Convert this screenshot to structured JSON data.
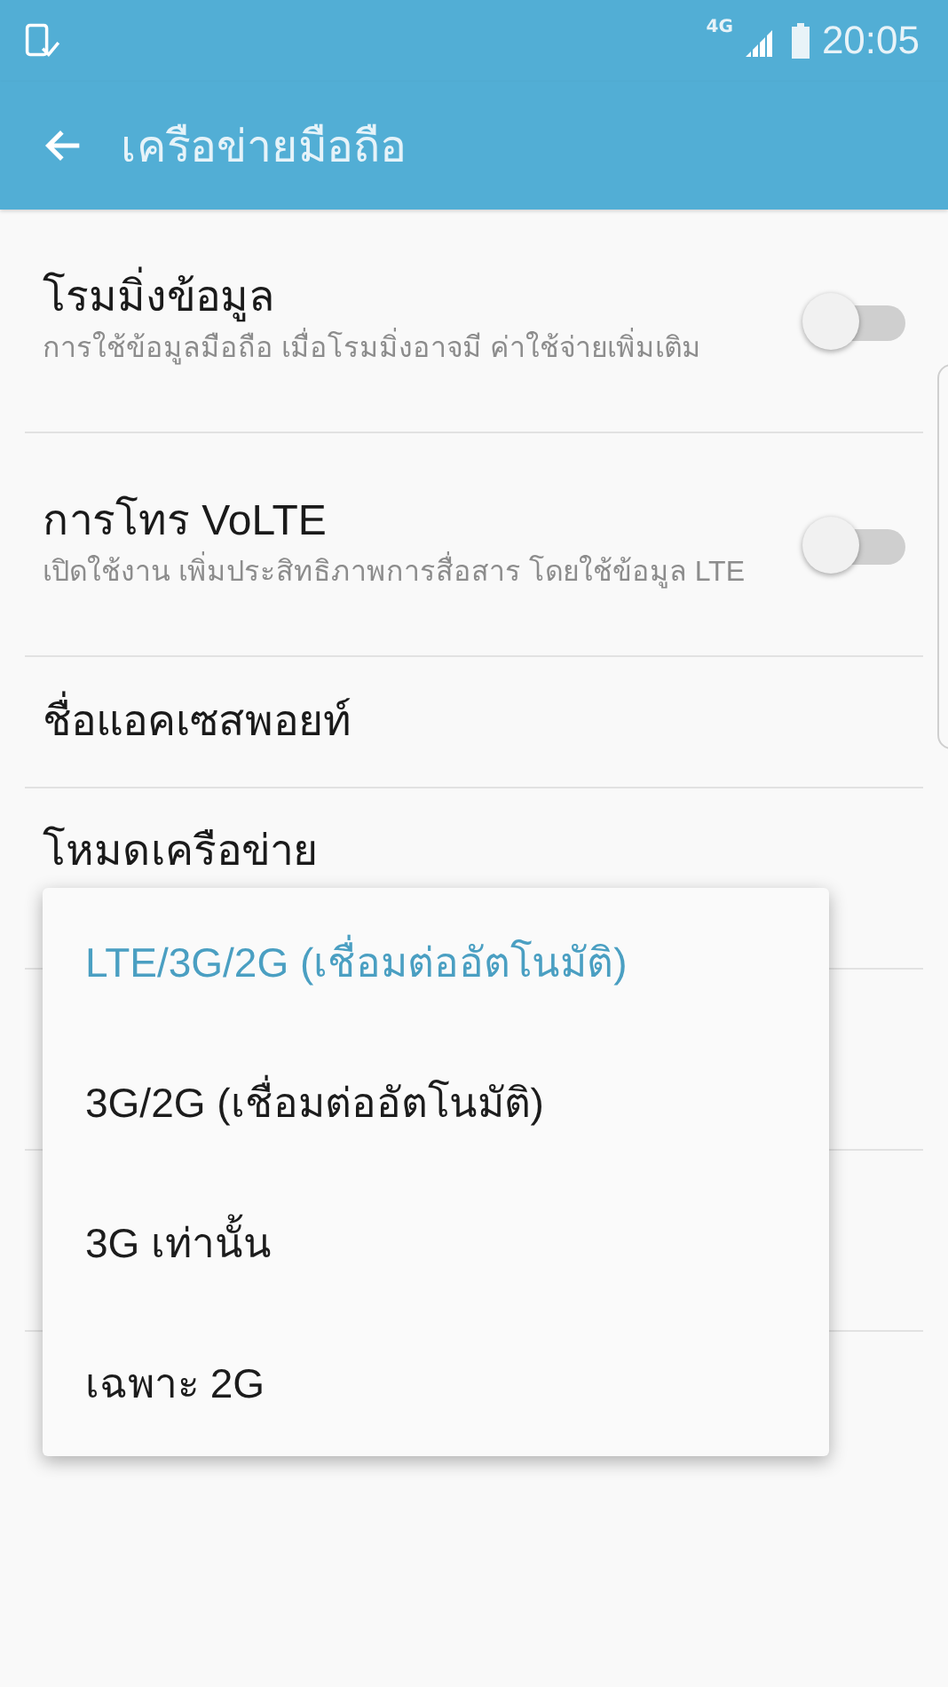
{
  "status_bar": {
    "network_type": "4G",
    "time": "20:05"
  },
  "app_bar": {
    "title": "เครือข่ายมือถือ"
  },
  "settings": [
    {
      "kind": "toggle",
      "title": "โรมมิ่งข้อมูล",
      "summary": "การใช้ข้อมูลมือถือ เมื่อโรมมิ่งอาจมี ค่าใช้จ่ายเพิ่มเติม",
      "on": false
    },
    {
      "kind": "toggle",
      "title": "การโทร VoLTE",
      "summary": "เปิดใช้งาน เพิ่มประสิทธิภาพการสื่อสาร โดยใช้ข้อมูล LTE",
      "on": false
    },
    {
      "kind": "plain",
      "title": "ชื่อแอคเซสพอยท์"
    },
    {
      "kind": "plain",
      "title": "โหมดเครือข่าย"
    }
  ],
  "popup_menu": {
    "items": [
      {
        "label": "LTE/3G/2G (เชื่อมต่ออัตโนมัติ)",
        "selected": true
      },
      {
        "label": "3G/2G (เชื่อมต่ออัตโนมัติ)",
        "selected": false
      },
      {
        "label": "3G เท่านั้น",
        "selected": false
      },
      {
        "label": "เฉพาะ 2G",
        "selected": false
      }
    ]
  }
}
